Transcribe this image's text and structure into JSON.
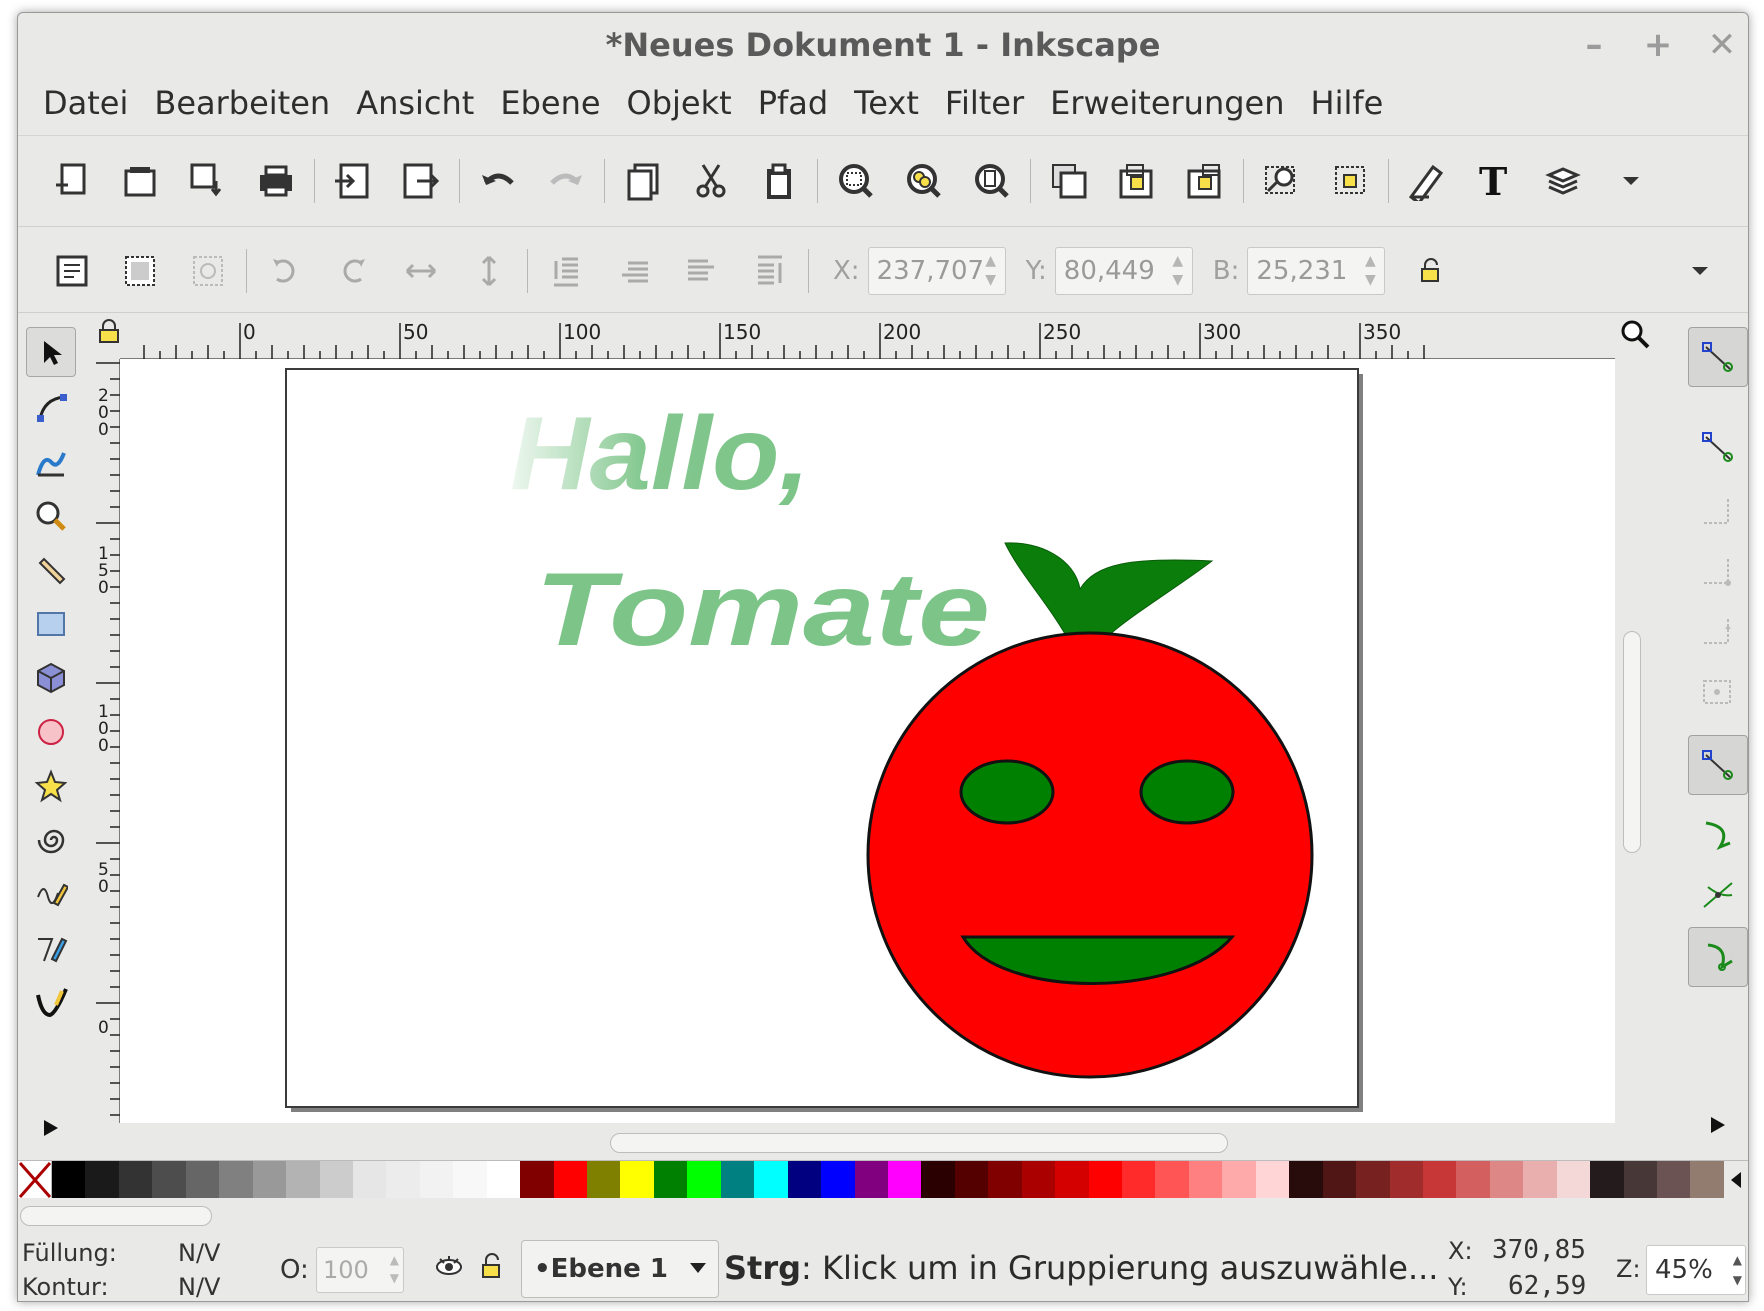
{
  "window": {
    "title": "*Neues Dokument 1 - Inkscape",
    "controls": [
      "–",
      "+",
      "✕"
    ]
  },
  "menu": [
    "Datei",
    "Bearbeiten",
    "Ansicht",
    "Ebene",
    "Objekt",
    "Pfad",
    "Text",
    "Filter",
    "Erweiterungen",
    "Hilfe"
  ],
  "toolbar2": {
    "x_label": "X:",
    "x_value": "237,707",
    "y_label": "Y:",
    "y_value": "80,449",
    "w_label": "B:",
    "w_value": "25,231"
  },
  "ruler": {
    "top": [
      "0",
      "50",
      "100",
      "150",
      "200",
      "250",
      "300",
      "350"
    ],
    "left": [
      "200",
      "150",
      "100",
      "50",
      "0"
    ]
  },
  "canvas": {
    "text_line1": "Hallo,",
    "text_line2": "Tomate"
  },
  "palette": [
    "#000000",
    "#1a1a1a",
    "#333333",
    "#4d4d4d",
    "#666666",
    "#808080",
    "#999999",
    "#b3b3b3",
    "#cccccc",
    "#e6e6e6",
    "#ececec",
    "#f2f2f2",
    "#f8f8f8",
    "#ffffff",
    "#800000",
    "#ff0000",
    "#808000",
    "#ffff00",
    "#008000",
    "#00ff00",
    "#008080",
    "#00ffff",
    "#000080",
    "#0000ff",
    "#800080",
    "#ff00ff",
    "#2b0000",
    "#550000",
    "#800000",
    "#aa0000",
    "#d40000",
    "#ff0000",
    "#ff2a2a",
    "#ff5555",
    "#ff8080",
    "#ffaaaa",
    "#ffd5d5",
    "#280b0b",
    "#501616",
    "#782121",
    "#a02c2c",
    "#c83737",
    "#d35f5f",
    "#de8787",
    "#e9afaf",
    "#f4d7d7",
    "#241c1c",
    "#483737",
    "#6c5353",
    "#917c6f"
  ],
  "status": {
    "fill_label": "Füllung:",
    "fill_value": "N/V",
    "stroke_label": "Kontur:",
    "stroke_value": "N/V",
    "opacity_label": "O:",
    "opacity_value": "100",
    "layer": "•Ebene 1",
    "message_bold": "Strg",
    "message_rest": ": Klick um in Gruppierung auszuwähle...",
    "x_label": "X:",
    "x_value": "370,85",
    "y_label": "Y:",
    "y_value": "62,59",
    "zoom_label": "Z:",
    "zoom_value": "45%"
  }
}
